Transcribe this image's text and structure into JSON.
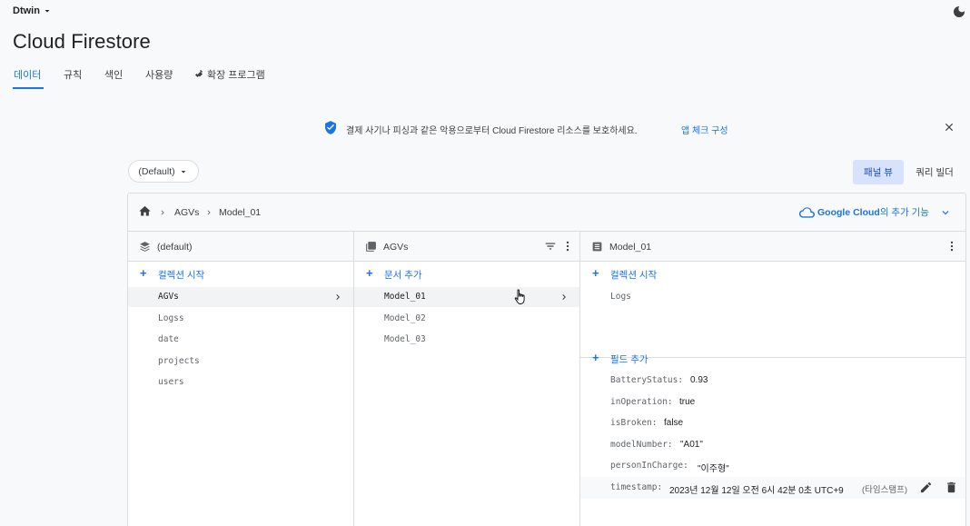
{
  "project": {
    "name": "Dtwin"
  },
  "page": {
    "title": "Cloud Firestore"
  },
  "tabs": [
    {
      "label": "데이터"
    },
    {
      "label": "규칙"
    },
    {
      "label": "색인"
    },
    {
      "label": "사용량"
    },
    {
      "label": "확장 프로그램"
    }
  ],
  "banner": {
    "message": "결제 사기나 피싱과 같은 악용으로부터 Cloud Firestore 리소스를 보호하세요.",
    "link": "앱 체크 구성"
  },
  "database_select": {
    "value": "(Default)"
  },
  "view_toggle": {
    "panel": "패널 뷰",
    "query": "쿼리 빌더"
  },
  "breadcrumb": {
    "items": [
      "AGVs",
      "Model_01"
    ]
  },
  "google_cloud": {
    "brand": "Google Cloud",
    "suffix": "의 추가 기능"
  },
  "columns": {
    "root": {
      "title": "(default)",
      "add_label": "컬렉션 시작",
      "items": [
        "AGVs",
        "Logss",
        "date",
        "projects",
        "users"
      ],
      "selected": "AGVs"
    },
    "collection": {
      "title": "AGVs",
      "add_label": "문서 추가",
      "items": [
        "Model_01",
        "Model_02",
        "Model_03"
      ],
      "selected": "Model_01"
    },
    "document": {
      "title": "Model_01",
      "add_collection_label": "컬렉션 시작",
      "subcollections": [
        "Logs"
      ],
      "add_field_label": "필드 추가",
      "fields": [
        {
          "key": "BatteryStatus:",
          "value": "0.93"
        },
        {
          "key": "inOperation:",
          "value": "true"
        },
        {
          "key": "isBroken:",
          "value": "false"
        },
        {
          "key": "modelNumber:",
          "value": "\"A01\""
        },
        {
          "key": "personInCharge:",
          "value": "\"이주형\""
        },
        {
          "key": "timestamp:",
          "value": "2023년 12월 12일 오전 6시 42분 0초 UTC+9",
          "type": "(타임스탬프)"
        }
      ]
    }
  },
  "colors": {
    "accent": "#1a73e8",
    "selected_bg": "#f1f3f4",
    "panel_active_bg": "#d7e3fc"
  }
}
